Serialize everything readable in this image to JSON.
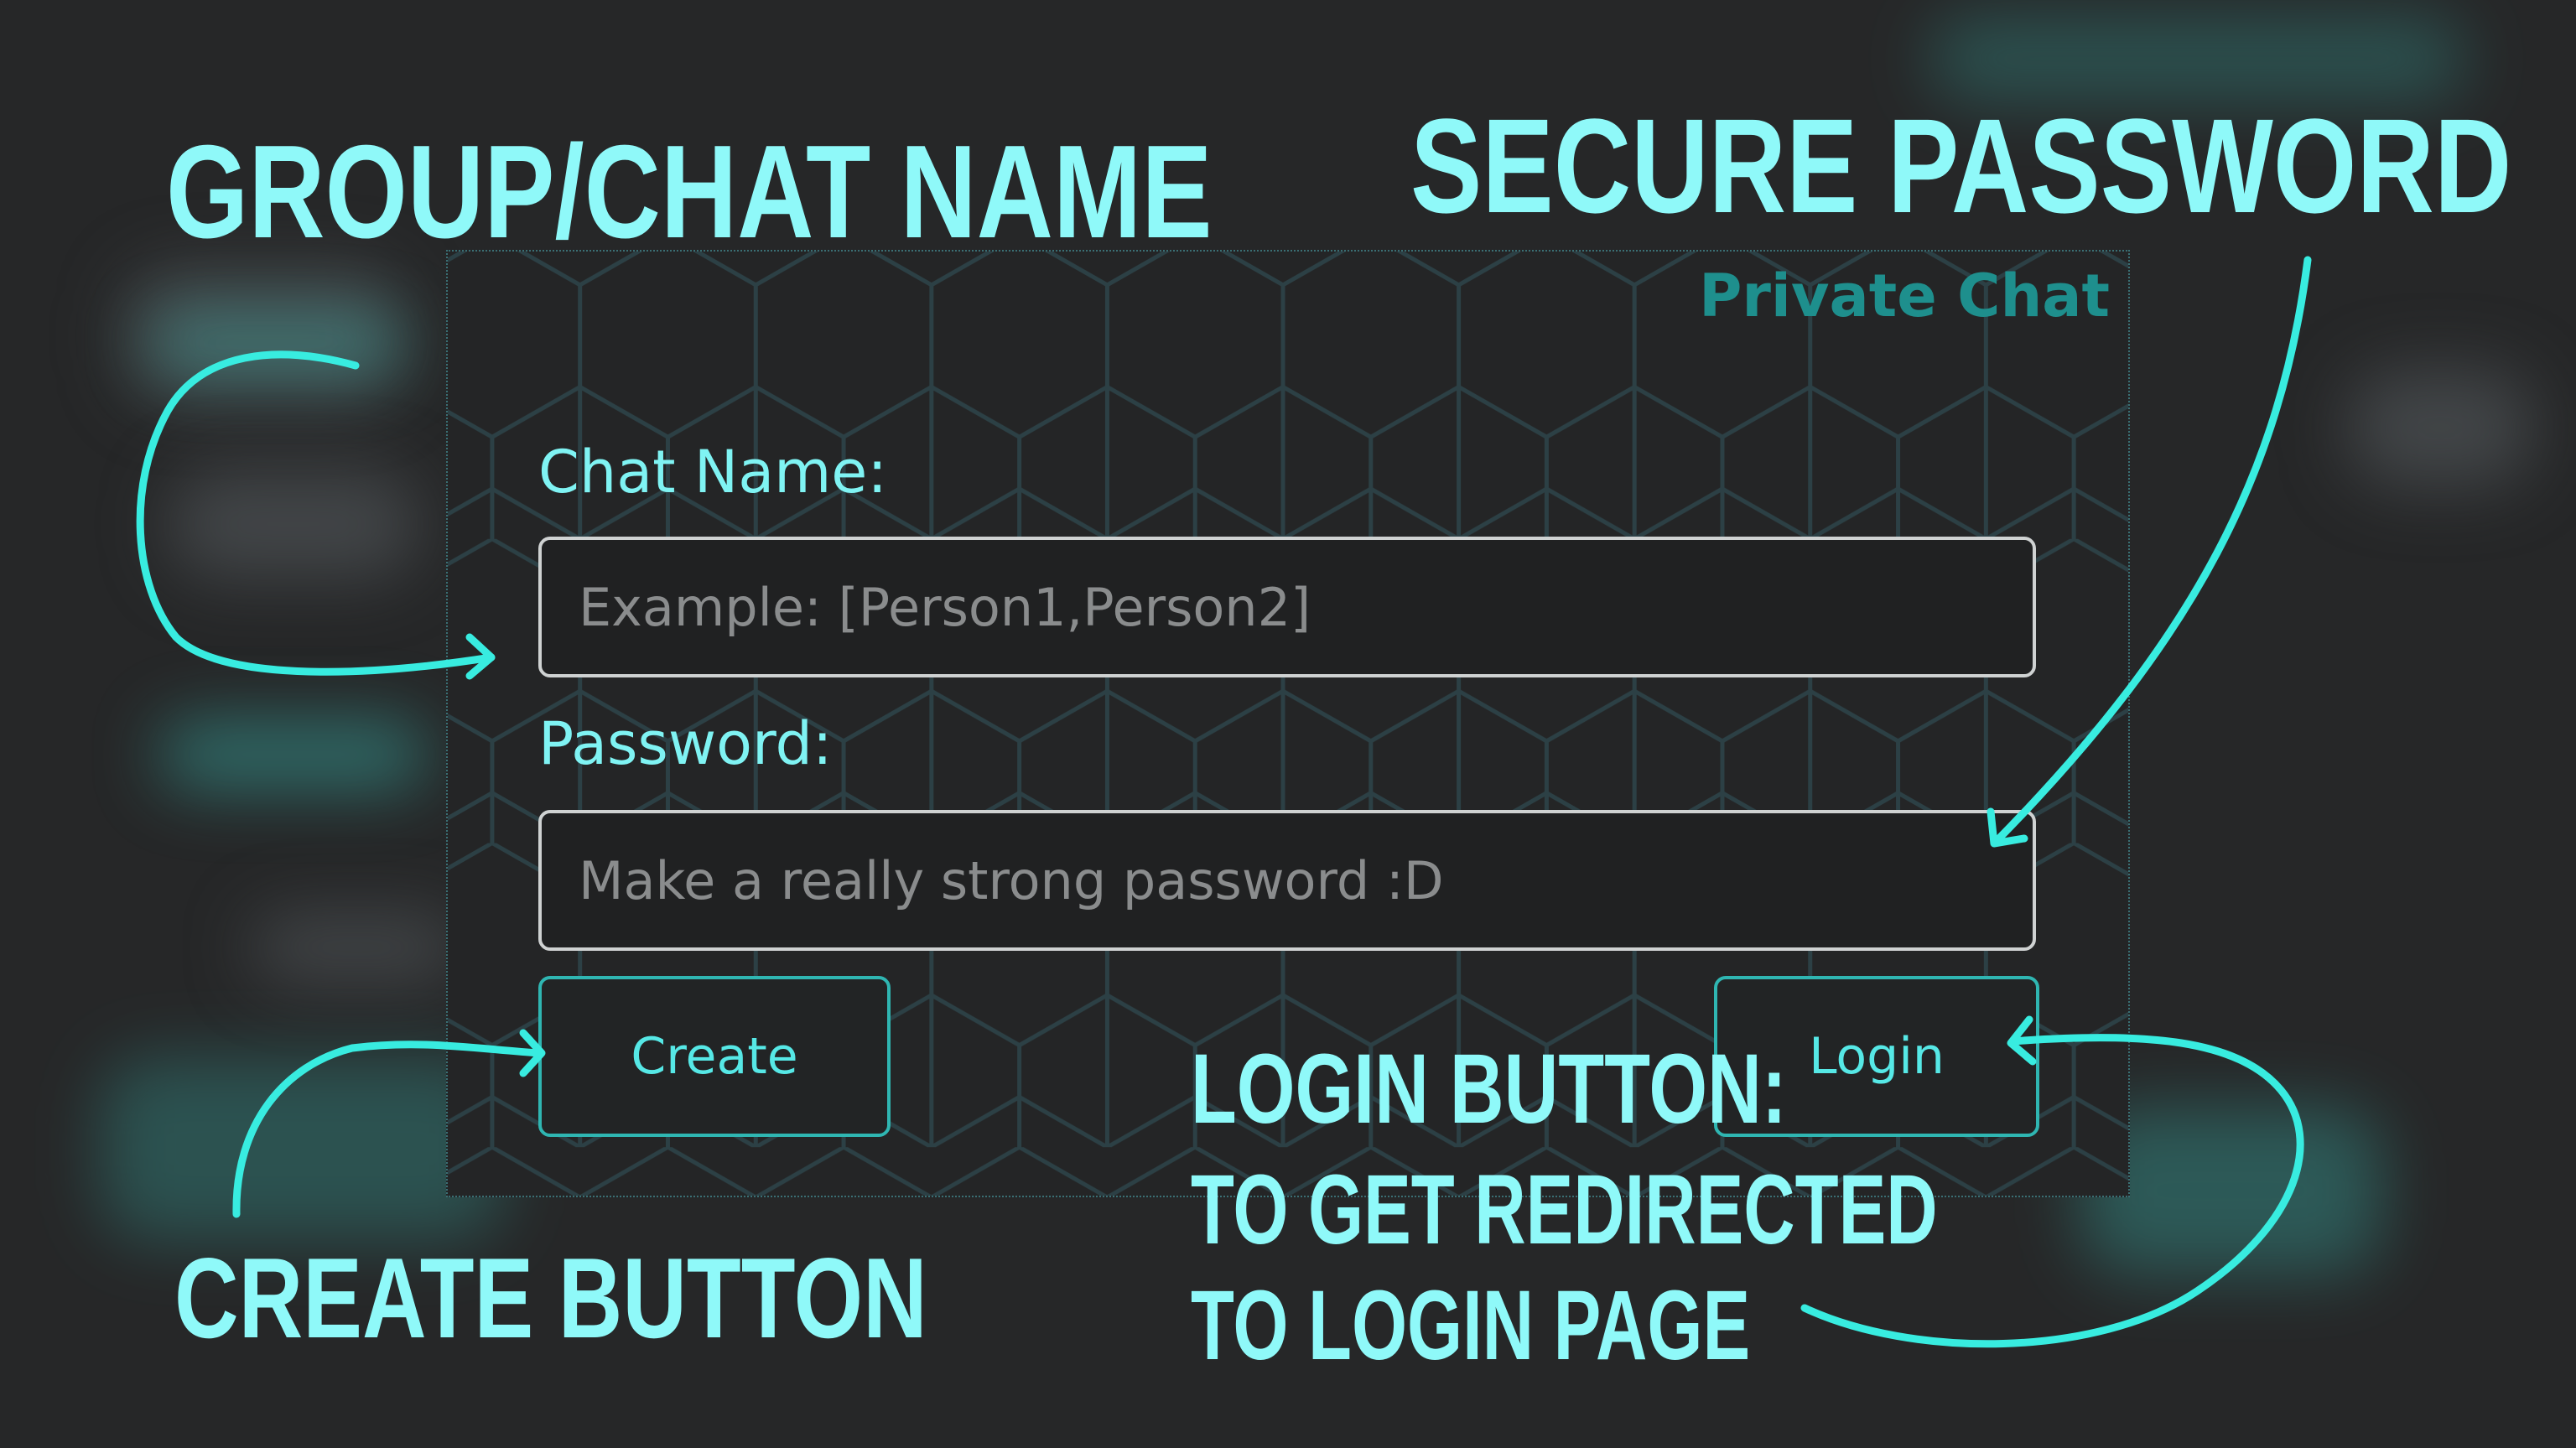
{
  "form": {
    "title": "Private Chat",
    "chat_name_label": "Chat Name:",
    "chat_name_placeholder": "Example: [Person1,Person2]",
    "password_label": "Password:",
    "password_placeholder": "Make a really strong password :D",
    "create_label": "Create",
    "login_label": "Login"
  },
  "annotations": {
    "group_chat_name": "GROUP/CHAT NAME",
    "secure_password": "SECURE PASSWORD",
    "create_button": "CREATE BUTTON",
    "login_line1": "LOGIN BUTTON:",
    "login_line2": "TO GET REDIRECTED",
    "login_line3": "TO LOGIN PAGE"
  },
  "colors": {
    "background": "#262728",
    "accent": "#2fb6b2",
    "annotation": "#8ff9f9",
    "title": "#1e8f8d"
  }
}
